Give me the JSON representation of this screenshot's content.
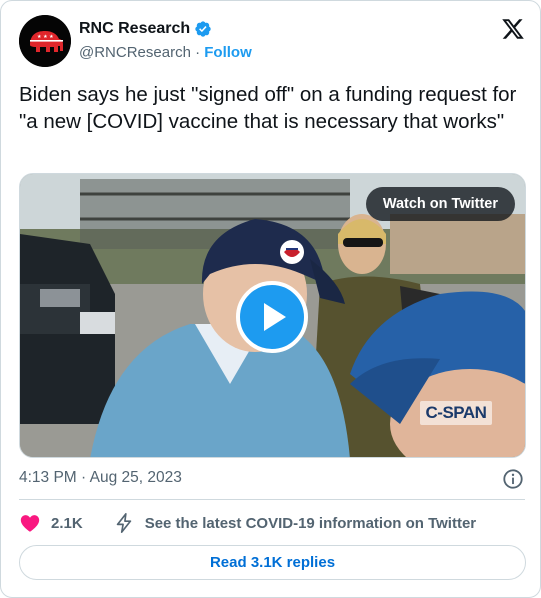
{
  "account": {
    "display_name": "RNC Research",
    "handle": "@RNCResearch",
    "separator": "·",
    "follow_label": "Follow",
    "verified": true,
    "verified_color": "#1d9bf0",
    "avatar_icon": "republican-elephant-logo"
  },
  "tweet": {
    "text": "Biden says he just \"signed off\" on a funding request for \"a new [COVID] vaccine that is necessary that works\""
  },
  "media": {
    "type": "video",
    "watch_label": "Watch on Twitter",
    "watermark": "C-SPAN",
    "play_icon": "play-icon"
  },
  "meta": {
    "timestamp": "4:13 PM · Aug 25, 2023",
    "info_icon": "info-icon"
  },
  "actions": {
    "like_count": "2.1K",
    "like_icon": "heart-icon",
    "covid_label": "See the latest COVID-19 information on Twitter",
    "covid_icon": "lightning-icon"
  },
  "replies": {
    "label": "Read 3.1K replies"
  },
  "colors": {
    "accent": "#1d9bf0",
    "heart": "#f91880",
    "text_secondary": "#536471",
    "link_dark": "#006fd6"
  }
}
